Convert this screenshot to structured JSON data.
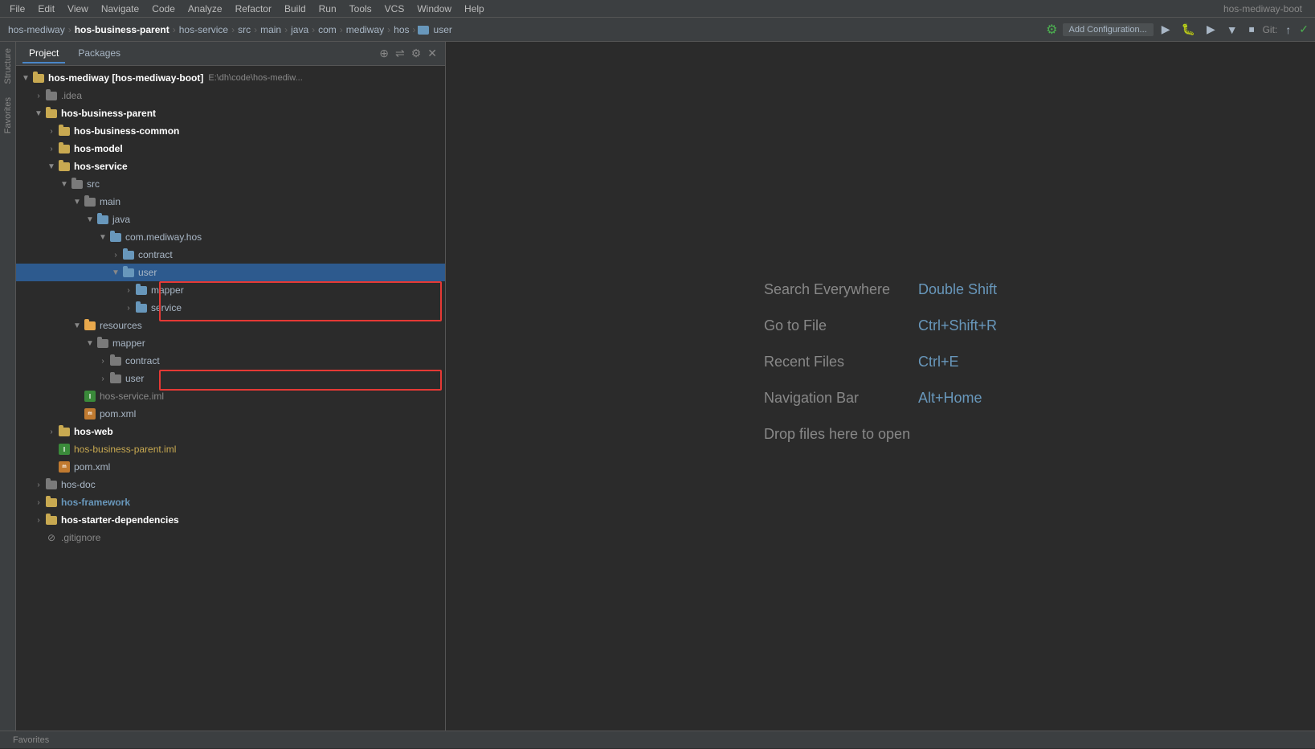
{
  "app": {
    "title": "hos-mediway-boot"
  },
  "menu": {
    "items": [
      "File",
      "Edit",
      "View",
      "Navigate",
      "Code",
      "Analyze",
      "Refactor",
      "Build",
      "Run",
      "Tools",
      "VCS",
      "Window",
      "Help"
    ]
  },
  "breadcrumb": {
    "items": [
      {
        "label": "hos-mediway",
        "bold": false
      },
      {
        "label": "hos-business-parent",
        "bold": true
      },
      {
        "label": "hos-service",
        "bold": false
      },
      {
        "label": "src",
        "bold": false
      },
      {
        "label": "main",
        "bold": false
      },
      {
        "label": "java",
        "bold": false
      },
      {
        "label": "com",
        "bold": false
      },
      {
        "label": "mediway",
        "bold": false
      },
      {
        "label": "hos",
        "bold": false
      },
      {
        "label": "user",
        "bold": false,
        "hasIcon": true
      }
    ]
  },
  "toolbar": {
    "add_config_label": "Add Configuration...",
    "git_label": "Git:",
    "git_check": "✓"
  },
  "panel": {
    "tabs": [
      "Project",
      "Packages"
    ],
    "active_tab": "Project"
  },
  "tree": {
    "root_label": "hos-mediway [hos-mediway-boot]",
    "root_path": "E:\\dh\\code\\hos-mediw...",
    "items": [
      {
        "id": "idea",
        "label": ".idea",
        "indent": 1,
        "collapsed": true,
        "type": "folder"
      },
      {
        "id": "hos-business-parent",
        "label": "hos-business-parent",
        "indent": 1,
        "collapsed": false,
        "type": "folder",
        "bold": true
      },
      {
        "id": "hos-business-common",
        "label": "hos-business-common",
        "indent": 2,
        "collapsed": true,
        "type": "folder",
        "bold": true
      },
      {
        "id": "hos-model",
        "label": "hos-model",
        "indent": 2,
        "collapsed": true,
        "type": "folder",
        "bold": true
      },
      {
        "id": "hos-service",
        "label": "hos-service",
        "indent": 2,
        "collapsed": false,
        "type": "folder",
        "bold": true
      },
      {
        "id": "src",
        "label": "src",
        "indent": 3,
        "collapsed": false,
        "type": "folder"
      },
      {
        "id": "main",
        "label": "main",
        "indent": 4,
        "collapsed": false,
        "type": "folder"
      },
      {
        "id": "java",
        "label": "java",
        "indent": 5,
        "collapsed": false,
        "type": "folder"
      },
      {
        "id": "com-mediway-hos",
        "label": "com.mediway.hos",
        "indent": 6,
        "collapsed": false,
        "type": "folder"
      },
      {
        "id": "contract",
        "label": "contract",
        "indent": 7,
        "collapsed": true,
        "type": "folder"
      },
      {
        "id": "user",
        "label": "user",
        "indent": 7,
        "collapsed": false,
        "type": "folder",
        "selected": true
      },
      {
        "id": "mapper",
        "label": "mapper",
        "indent": 8,
        "collapsed": true,
        "type": "folder",
        "redBox": true
      },
      {
        "id": "service",
        "label": "service",
        "indent": 8,
        "collapsed": true,
        "type": "folder",
        "redBox": true
      },
      {
        "id": "resources",
        "label": "resources",
        "indent": 4,
        "collapsed": false,
        "type": "folder"
      },
      {
        "id": "mapper2",
        "label": "mapper",
        "indent": 5,
        "collapsed": false,
        "type": "folder"
      },
      {
        "id": "contract2",
        "label": "contract",
        "indent": 6,
        "collapsed": true,
        "type": "folder"
      },
      {
        "id": "user2",
        "label": "user",
        "indent": 6,
        "collapsed": true,
        "type": "folder",
        "redBox2": true
      },
      {
        "id": "hos-service-iml",
        "label": "hos-service.iml",
        "indent": 3,
        "type": "iml"
      },
      {
        "id": "pom-xml-1",
        "label": "pom.xml",
        "indent": 3,
        "type": "xml"
      },
      {
        "id": "hos-web",
        "label": "hos-web",
        "indent": 2,
        "collapsed": true,
        "type": "folder",
        "bold": true
      },
      {
        "id": "hos-business-parent-iml",
        "label": "hos-business-parent.iml",
        "indent": 2,
        "type": "iml",
        "yellow": true
      },
      {
        "id": "pom-xml-2",
        "label": "pom.xml",
        "indent": 2,
        "type": "xml"
      },
      {
        "id": "hos-doc",
        "label": "hos-doc",
        "indent": 1,
        "collapsed": true,
        "type": "folder"
      },
      {
        "id": "hos-framework",
        "label": "hos-framework",
        "indent": 1,
        "collapsed": true,
        "type": "folder",
        "bold": true,
        "blue": true
      },
      {
        "id": "hos-starter-dependencies",
        "label": "hos-starter-dependencies",
        "indent": 1,
        "collapsed": true,
        "type": "folder",
        "bold": true
      },
      {
        "id": "gitignore",
        "label": ".gitignore",
        "indent": 1,
        "type": "git"
      }
    ]
  },
  "welcome": {
    "rows": [
      {
        "label": "Search Everywhere",
        "shortcut": "Double Shift"
      },
      {
        "label": "Go to File",
        "shortcut": "Ctrl+Shift+R"
      },
      {
        "label": "Recent Files",
        "shortcut": "Ctrl+E"
      },
      {
        "label": "Navigation Bar",
        "shortcut": "Alt+Home"
      },
      {
        "label": "Drop files here to open",
        "shortcut": ""
      }
    ]
  },
  "bottom_tabs": {
    "items": [
      "Favorites"
    ]
  },
  "side_tabs": {
    "items": [
      "Structure",
      "Favorites"
    ]
  }
}
